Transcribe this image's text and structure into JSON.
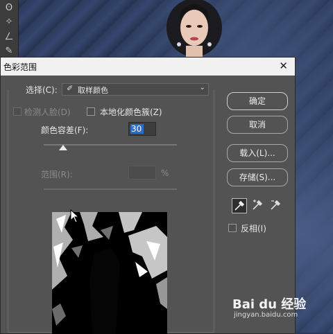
{
  "dialog": {
    "title": "色彩范围",
    "close_glyph": "✕",
    "select": {
      "label": "选择(C):",
      "value": "取样颜色",
      "icon": "eyedropper-icon"
    },
    "detect_faces": {
      "label": "检测人脸(D)",
      "checked": false,
      "enabled": false
    },
    "localized_clusters": {
      "label": "本地化颜色簇(Z)",
      "checked": false
    },
    "fuzziness": {
      "label": "颜色容差(F):",
      "value": "30"
    },
    "range": {
      "label": "范围(R):",
      "unit": "%",
      "enabled": false
    },
    "buttons": {
      "ok": "确定",
      "cancel": "取消",
      "load": "载入(L)...",
      "save": "存储(S)..."
    },
    "eyedroppers": [
      "eyedropper-icon",
      "eyedropper-plus-icon",
      "eyedropper-minus-icon"
    ],
    "invert": {
      "label": "反相(I)",
      "checked": false
    }
  },
  "watermark": {
    "brand": "Bai du 经验",
    "site": "jingyan.baidu.com"
  },
  "colors": {
    "dialog_bg": "#535353",
    "selection": "#2f6cc4",
    "canvas_bg": "#2e3d60"
  }
}
